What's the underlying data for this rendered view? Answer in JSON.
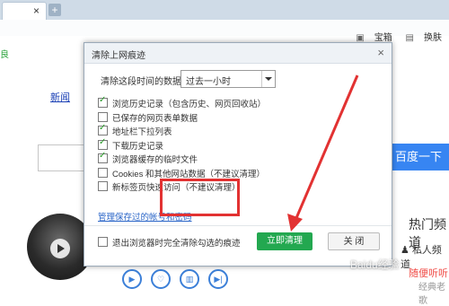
{
  "browser": {
    "tab_close_glyph": "×",
    "new_tab_glyph": "+",
    "addr_fragment": "良"
  },
  "page": {
    "toplinks": [
      {
        "label": "宝箱",
        "icon": "chest-icon"
      },
      {
        "label": "换肤",
        "icon": "skin-icon"
      }
    ],
    "news_link": "新闻",
    "search_button": "百度一下",
    "hot_heading": "热门频道",
    "private_channel": "私人频道",
    "private_2": "随便听听",
    "classic": "经典老歌",
    "watermark": "Baidu经验"
  },
  "dialog": {
    "title": "清除上网痕迹",
    "close_glyph": "×",
    "range_label": "清除这段时间的数据：",
    "range_value": "过去一小时",
    "options": [
      {
        "label": "浏览历史记录（包含历史、网页回收站）",
        "checked": true
      },
      {
        "label": "已保存的网页表单数据",
        "checked": false
      },
      {
        "label": "地址栏下拉列表",
        "checked": true
      },
      {
        "label": "下载历史记录",
        "checked": true
      },
      {
        "label": "浏览器缓存的临时文件",
        "checked": true
      },
      {
        "label": "Cookies 和其他网站数据（不建议清理）",
        "checked": false
      },
      {
        "label": "新标签页快速访问（不建议清理）",
        "checked": false
      }
    ],
    "manage_link": "管理保存过的帐号和密码",
    "exit_option": "退出浏览器时完全清除勾选的痕迹",
    "exit_checked": false,
    "clear_button": "立即清理",
    "close_button": "关 闭"
  },
  "colors": {
    "clear_button": "#23a850",
    "highlight": "#e23232",
    "search_button": "#3785f2"
  }
}
